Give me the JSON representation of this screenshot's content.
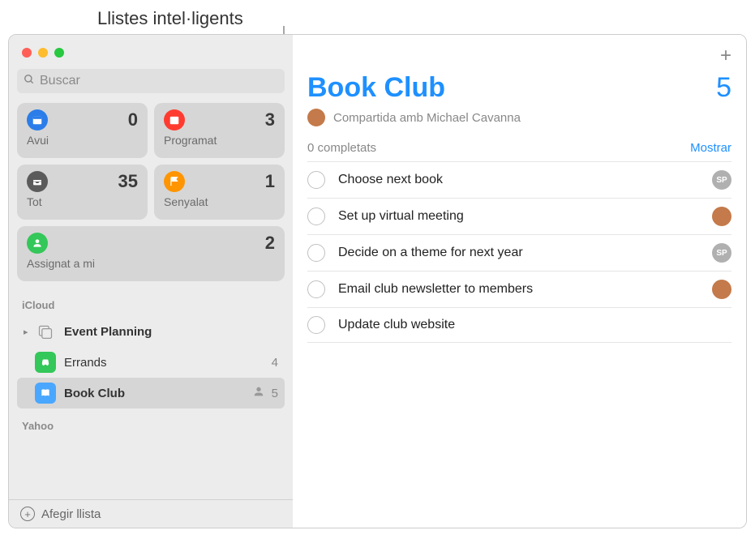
{
  "annotation": {
    "label": "Llistes intel·ligents"
  },
  "search": {
    "placeholder": "Buscar"
  },
  "smart": {
    "today": {
      "label": "Avui",
      "count": "0"
    },
    "scheduled": {
      "label": "Programat",
      "count": "3"
    },
    "all": {
      "label": "Tot",
      "count": "35"
    },
    "flagged": {
      "label": "Senyalat",
      "count": "1"
    },
    "assigned": {
      "label": "Assignat a mi",
      "count": "2"
    }
  },
  "accounts": {
    "icloud": {
      "label": "iCloud",
      "lists": [
        {
          "name": "Event Planning",
          "count": "",
          "bold": true
        },
        {
          "name": "Errands",
          "count": "4"
        },
        {
          "name": "Book Club",
          "count": "5",
          "shared": true,
          "selected": true
        }
      ]
    },
    "yahoo": {
      "label": "Yahoo"
    }
  },
  "footer": {
    "add_list": "Afegir llista"
  },
  "main": {
    "title": "Book Club",
    "count": "5",
    "shared_with": "Compartida amb Michael Cavanna",
    "completed_label": "0 completats",
    "show_label": "Mostrar",
    "tasks": [
      {
        "title": "Choose next book",
        "assignee_type": "initials",
        "initials": "SP"
      },
      {
        "title": "Set up virtual meeting",
        "assignee_type": "photo"
      },
      {
        "title": "Decide on a theme for next year",
        "assignee_type": "initials",
        "initials": "SP"
      },
      {
        "title": "Email club newsletter to members",
        "assignee_type": "photo"
      },
      {
        "title": "Update club website",
        "assignee_type": "none"
      }
    ]
  }
}
